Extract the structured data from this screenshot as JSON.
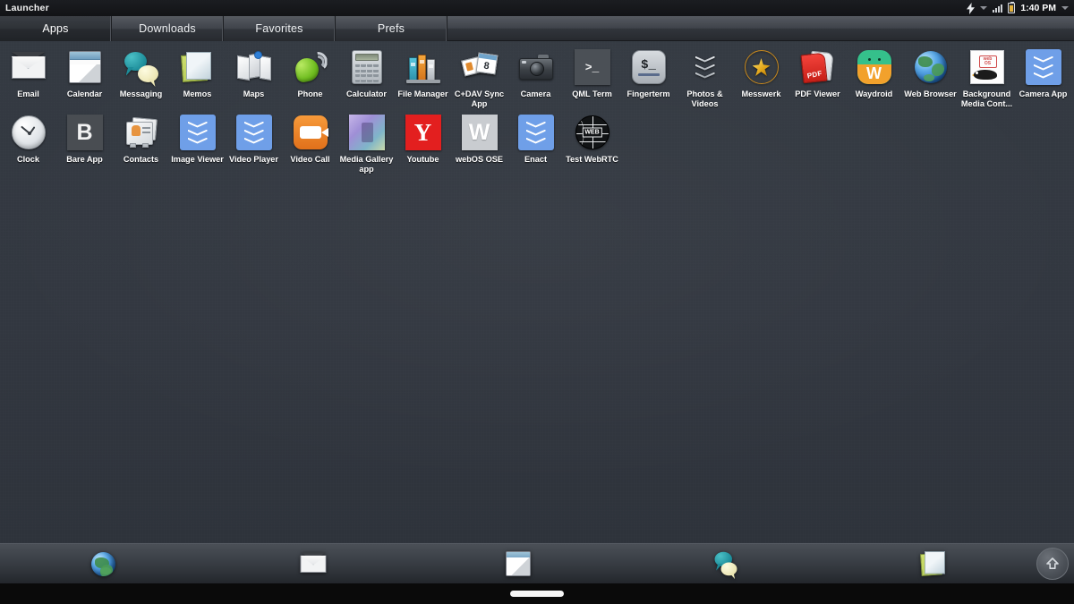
{
  "statusbar": {
    "title": "Launcher",
    "time": "1:40 PM",
    "charging_icon": "lightning-bolt-icon",
    "signal_icon": "signal-bars-icon",
    "battery_icon": "battery-icon"
  },
  "tabs": [
    {
      "label": "Apps",
      "active": true
    },
    {
      "label": "Downloads",
      "active": false
    },
    {
      "label": "Favorites",
      "active": false
    },
    {
      "label": "Prefs",
      "active": false
    }
  ],
  "apps": {
    "row1": [
      {
        "label": "Email",
        "icon": "email-icon"
      },
      {
        "label": "Calendar",
        "icon": "calendar-icon"
      },
      {
        "label": "Messaging",
        "icon": "messaging-icon"
      },
      {
        "label": "Memos",
        "icon": "memos-icon"
      },
      {
        "label": "Maps",
        "icon": "maps-icon"
      },
      {
        "label": "Phone",
        "icon": "phone-icon"
      },
      {
        "label": "Calculator",
        "icon": "calculator-icon"
      },
      {
        "label": "File Manager",
        "icon": "file-manager-icon"
      },
      {
        "label": "C+DAV Sync App",
        "icon": "cdav-sync-icon"
      },
      {
        "label": "Camera",
        "icon": "camera-icon"
      },
      {
        "label": "QML Term",
        "icon": "qml-term-icon"
      },
      {
        "label": "Fingerterm",
        "icon": "fingerterm-icon"
      },
      {
        "label": "Photos & Videos",
        "icon": "photos-videos-icon"
      },
      {
        "label": "Messwerk",
        "icon": "messwerk-icon"
      },
      {
        "label": "PDF Viewer",
        "icon": "pdf-viewer-icon"
      },
      {
        "label": "Waydroid",
        "icon": "waydroid-icon"
      },
      {
        "label": "Web Browser",
        "icon": "web-browser-icon"
      },
      {
        "label": "Background Media Cont...",
        "icon": "background-media-control-icon"
      },
      {
        "label": "Camera App",
        "icon": "camera-app-icon"
      }
    ],
    "row2": [
      {
        "label": "Clock",
        "icon": "clock-icon"
      },
      {
        "label": "Bare App",
        "icon": "bare-app-icon"
      },
      {
        "label": "Contacts",
        "icon": "contacts-icon"
      },
      {
        "label": "Image Viewer",
        "icon": "image-viewer-icon"
      },
      {
        "label": "Video Player",
        "icon": "video-player-icon"
      },
      {
        "label": "Video Call",
        "icon": "video-call-icon"
      },
      {
        "label": "Media Gallery app",
        "icon": "media-gallery-icon"
      },
      {
        "label": "Youtube",
        "icon": "youtube-icon"
      },
      {
        "label": "webOS OSE",
        "icon": "webos-ose-icon"
      },
      {
        "label": "Enact",
        "icon": "enact-icon"
      },
      {
        "label": "Test WebRTC",
        "icon": "test-webrtc-icon"
      }
    ]
  },
  "dock": [
    {
      "name": "web-browser",
      "icon": "globe-icon"
    },
    {
      "name": "email",
      "icon": "envelope-icon"
    },
    {
      "name": "calendar",
      "icon": "calendar-icon"
    },
    {
      "name": "messaging",
      "icon": "speech-bubbles-icon"
    },
    {
      "name": "memos",
      "icon": "notes-icon"
    },
    {
      "name": "launcher",
      "icon": "up-arrow-icon"
    }
  ],
  "navbar": {
    "gesture_bar": "home-gesture-bar"
  },
  "colors": {
    "wallpaper": "#343a42",
    "statusbar": "#16181b",
    "dock": "#3b4047",
    "accent_blue": "#6f9fe8",
    "label_text": "#ffffff"
  }
}
